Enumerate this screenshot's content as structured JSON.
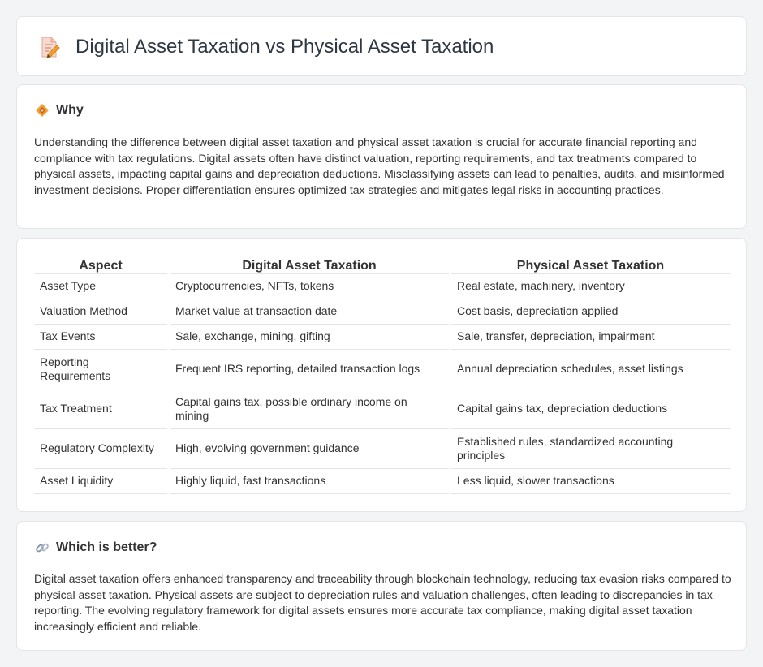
{
  "header": {
    "title": "Digital Asset Taxation vs Physical Asset Taxation",
    "icon": "document-pen-icon"
  },
  "why": {
    "title": "Why",
    "icon": "diamond-icon",
    "text": "Understanding the difference between digital asset taxation and physical asset taxation is crucial for accurate financial reporting and compliance with tax regulations. Digital assets often have distinct valuation, reporting requirements, and tax treatments compared to physical assets, impacting capital gains and depreciation deductions. Misclassifying assets can lead to penalties, audits, and misinformed investment decisions. Proper differentiation ensures optimized tax strategies and mitigates legal risks in accounting practices."
  },
  "comparison": {
    "headers": [
      "Aspect",
      "Digital Asset Taxation",
      "Physical Asset Taxation"
    ],
    "rows": [
      [
        "Asset Type",
        "Cryptocurrencies, NFTs, tokens",
        "Real estate, machinery, inventory"
      ],
      [
        "Valuation Method",
        "Market value at transaction date",
        "Cost basis, depreciation applied"
      ],
      [
        "Tax Events",
        "Sale, exchange, mining, gifting",
        "Sale, transfer, depreciation, impairment"
      ],
      [
        "Reporting Requirements",
        "Frequent IRS reporting, detailed transaction logs",
        "Annual depreciation schedules, asset listings"
      ],
      [
        "Tax Treatment",
        "Capital gains tax, possible ordinary income on mining",
        "Capital gains tax, depreciation deductions"
      ],
      [
        "Regulatory Complexity",
        "High, evolving government guidance",
        "Established rules, standardized accounting principles"
      ],
      [
        "Asset Liquidity",
        "Highly liquid, fast transactions",
        "Less liquid, slower transactions"
      ]
    ]
  },
  "better": {
    "title": "Which is better?",
    "icon": "link-icon",
    "text": "Digital asset taxation offers enhanced transparency and traceability through blockchain technology, reducing tax evasion risks compared to physical asset taxation. Physical assets are subject to depreciation rules and valuation challenges, often leading to discrepancies in tax reporting. The evolving regulatory framework for digital assets ensures more accurate tax compliance, making digital asset taxation increasingly efficient and reliable."
  },
  "colors": {
    "background": "#f3f4f6",
    "card": "#ffffff",
    "border": "#e3e5e8",
    "text": "#333333",
    "icon_accent": "#f0a033"
  }
}
